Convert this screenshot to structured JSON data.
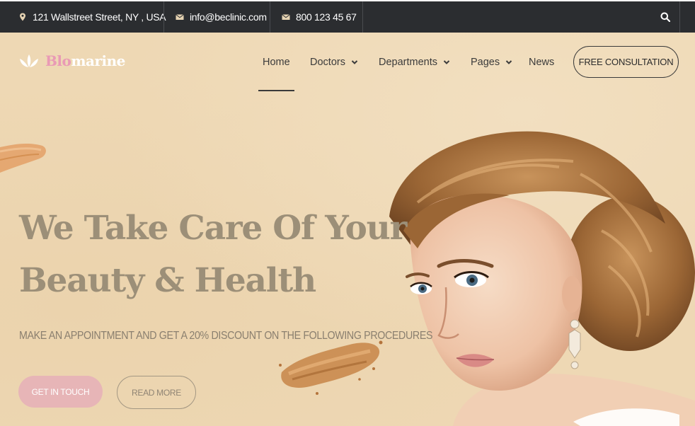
{
  "topbar": {
    "address": "121 Wallstreet Street, NY , USA",
    "email": "info@beclinic.com",
    "phone": "800 123 45 67",
    "icons": [
      "location-pin-icon",
      "envelope-icon",
      "envelope-icon",
      "search-icon"
    ]
  },
  "logo": {
    "part1": "Blo",
    "part2": "marine",
    "icon": "lotus-icon"
  },
  "nav": {
    "items": [
      {
        "label": "Home",
        "active": true,
        "dropdown": false
      },
      {
        "label": "Doctors",
        "active": false,
        "dropdown": true
      },
      {
        "label": "Departments",
        "active": false,
        "dropdown": true
      },
      {
        "label": "Pages",
        "active": false,
        "dropdown": true
      },
      {
        "label": "News",
        "active": false,
        "dropdown": false
      }
    ],
    "cta": "FREE CONSULTATION"
  },
  "hero": {
    "headline_line1": "We Take Care Of Your",
    "headline_line2": "Beauty & Health",
    "subline": "MAKE AN APPOINTMENT AND GET A 20% DISCOUNT ON THE FOLLOWING PROCEDURES",
    "primary_button": "GET IN TOUCH",
    "secondary_button": "READ MORE"
  },
  "colors": {
    "topbar_bg": "#2b2d30",
    "hero_bg": "#eed8b4",
    "brand_pink": "#e99ab5",
    "headline": "#9c8f78",
    "button_pink": "#e7b5b7"
  }
}
